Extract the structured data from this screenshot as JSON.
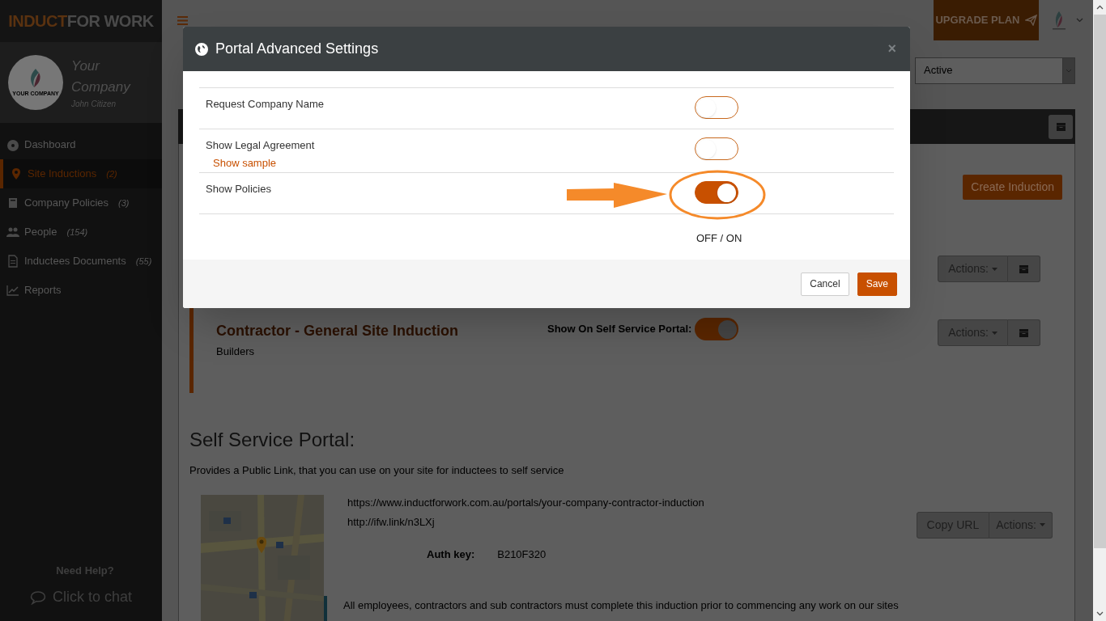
{
  "brand": {
    "logo_first": "INDUCT",
    "logo_second": "FOR WORK"
  },
  "profile": {
    "company_line_1": "Your",
    "company_line_2": "Company",
    "user": "John Citizen",
    "logo_text": "YOUR COMPANY"
  },
  "sidebar": {
    "items": [
      {
        "kind": "dashboard",
        "label": "Dashboard",
        "selected": false
      },
      {
        "kind": "pin",
        "label": "Site Inductions",
        "count": "(2)",
        "selected": true
      },
      {
        "kind": "book",
        "label": "Company Policies",
        "count": "(3)",
        "selected": false
      },
      {
        "kind": "people",
        "label": "People",
        "count": "(154)",
        "selected": false
      },
      {
        "kind": "document",
        "label": "Inductees Documents",
        "count": "(55)",
        "selected": false
      },
      {
        "kind": "chart",
        "label": "Reports",
        "selected": false
      }
    ],
    "help_title": "Need Help?",
    "chat_link": "Click to chat"
  },
  "topbar": {
    "upgrade_button": "UPGRADE PLAN"
  },
  "page": {
    "status_select": "Active",
    "create_button": "Create Induction",
    "inductions": [
      {
        "actions_button": "Actions:"
      },
      {
        "title": "Contractor - General Site Induction",
        "subtitle": "Builders",
        "portal_label": "Show On Self Service Portal:",
        "portal_on": true,
        "actions_button": "Actions:"
      }
    ],
    "portal": {
      "heading": "Self Service Portal:",
      "description": "Provides a Public Link, that you can use on your site for inductees to self service",
      "url": "https://www.inductforwork.com.au/portals/your-company-contractor-induction",
      "short_url": "http://ifw.link/n3LXj",
      "auth_label": "Auth key:",
      "auth_value": "B210F320",
      "copy_button": "Copy URL",
      "actions_button": "Actions:",
      "notice": "All employees, contractors and sub contractors must complete this induction prior to commencing any work on our sites"
    }
  },
  "modal": {
    "title": "Portal Advanced Settings",
    "close": "×",
    "settings": [
      {
        "label": "Request Company Name",
        "on": false
      },
      {
        "label": "Show Legal Agreement",
        "link": "Show sample",
        "on": false
      },
      {
        "label": "Show Policies",
        "on": true
      }
    ],
    "legend": "OFF / ON",
    "buttons": [
      {
        "label": "Cancel",
        "kind": "secondary"
      },
      {
        "label": "Save",
        "kind": "primary"
      }
    ]
  }
}
